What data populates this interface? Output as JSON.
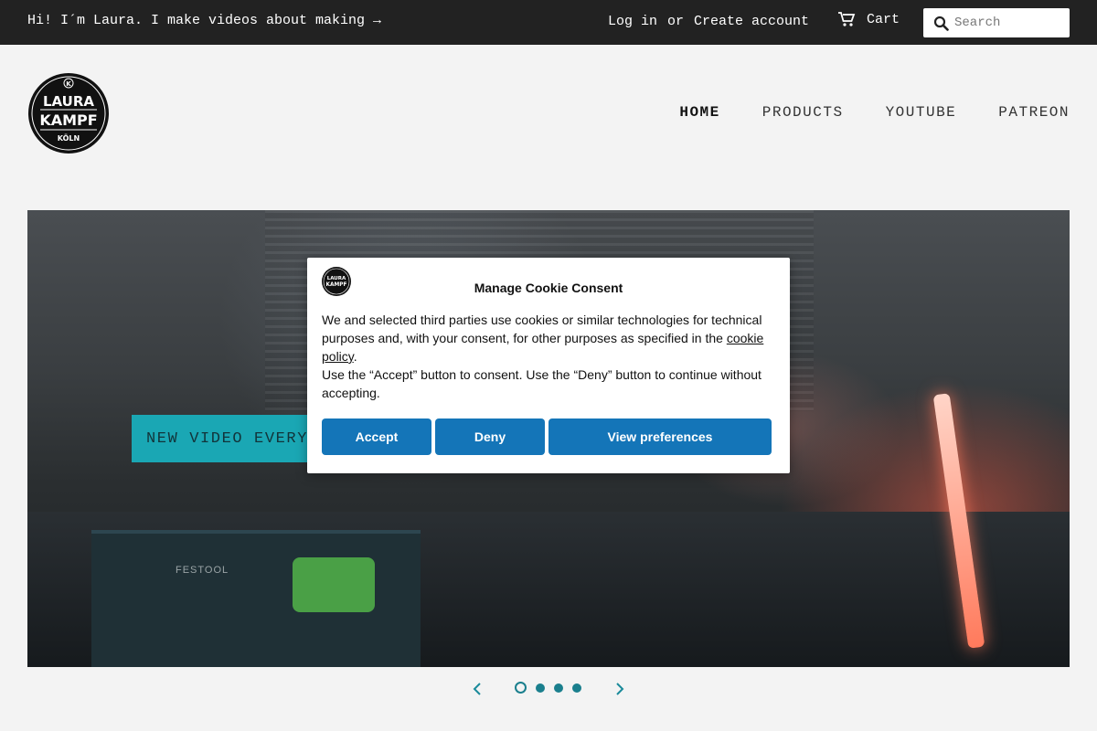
{
  "topbar": {
    "announcement": "Hi! I´m Laura. I make videos about making →",
    "login": "Log in",
    "or": "or",
    "create_account": "Create account",
    "cart": "Cart",
    "search_placeholder": "Search"
  },
  "logo": {
    "top_letter": "K",
    "line1": "LAURA",
    "line2": "KAMPF",
    "line3": "KÖLN"
  },
  "nav": {
    "items": [
      {
        "label": "HOME",
        "active": true
      },
      {
        "label": "PRODUCTS",
        "active": false
      },
      {
        "label": "YOUTUBE",
        "active": false
      },
      {
        "label": "PATREON",
        "active": false
      }
    ]
  },
  "hero": {
    "caption": "NEW VIDEO EVERY",
    "image_brand_text": "FESTOOL",
    "slides": 4,
    "active_slide": 1
  },
  "cookie": {
    "title": "Manage Cookie Consent",
    "body_1": "We and selected third parties use cookies or similar technologies for technical purposes and, with your consent, for other purposes as specified in the ",
    "policy_link": "cookie policy",
    "body_1_end": ".",
    "body_2": "Use the “Accept” button to consent. Use the “Deny” button to continue without accepting.",
    "accept": "Accept",
    "deny": "Deny",
    "preferences": "View preferences"
  },
  "colors": {
    "topbar_bg": "#222222",
    "accent_teal": "#1aa7b4",
    "cookie_button": "#1475b8",
    "page_bg": "#f3f3f3"
  }
}
